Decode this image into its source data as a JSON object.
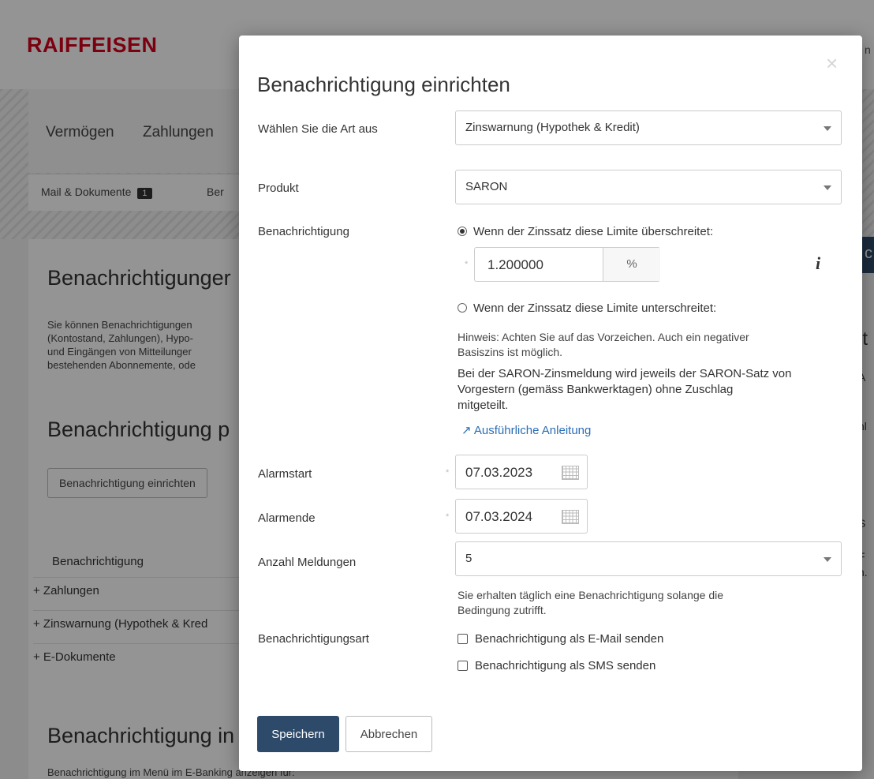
{
  "background": {
    "logo": "RAIFFEISEN",
    "top_right_fragment": "n",
    "nav": [
      "Vermögen",
      "Zahlungen"
    ],
    "subnav": {
      "mail_label": "Mail & Dokumente",
      "mail_count": "1",
      "second_fragment": "Ber"
    },
    "heading_1": "Benachrichtigunger",
    "intro_lines": [
      "Sie können Benachrichtigungen",
      "(Kontostand, Zahlungen), Hypo-",
      "und Eingängen von Mitteilunger",
      "bestehenden Abonnemente, ode"
    ],
    "heading_2": "Benachrichtigung p",
    "create_button": "Benachrichtigung einrichten",
    "table_header": "Benachrichtigung",
    "rows": [
      "+ Zahlungen",
      "+ Zinswarnung (Hypothek & Kred",
      "+ E-Dokumente"
    ],
    "heading_3": "Benachrichtigung in",
    "footer_text": "Benachrichtigung im Menü im E-Banking anzeigen für:",
    "right_fragments": [
      "it",
      "A",
      "hl",
      "S",
      "F",
      "n."
    ],
    "right_button": "c"
  },
  "modal": {
    "title": "Benachrichtigung einrichten",
    "close_icon": "×",
    "type_label": "Wählen Sie die Art aus",
    "type_value": "Zinswarnung (Hypothek & Kredit)",
    "product_label": "Produkt",
    "product_value": "SARON",
    "notification_label": "Benachrichtigung",
    "radio_exceed": "Wenn der Zinssatz diese Limite überschreitet:",
    "rate_value": "1.200000",
    "rate_unit": "%",
    "info_icon": "i",
    "radio_below": "Wenn der Zinssatz diese Limite unterschreitet:",
    "hint_lines": [
      "Hinweis: Achten Sie auf das Vorzeichen. Auch ein negativer",
      "Basiszins ist möglich."
    ],
    "saron_note_lines": [
      "Bei der SARON-Zinsmeldung wird jeweils der SARON-Satz von",
      "Vorgestern (gemäss Bankwerktagen) ohne Zuschlag",
      "mitgeteilt."
    ],
    "guide_link": "↗ Ausführliche Anleitung",
    "start_label": "Alarmstart",
    "start_value": "07.03.2023",
    "end_label": "Alarmende",
    "end_value": "07.03.2024",
    "count_label": "Anzahl Meldungen",
    "count_value": "5",
    "count_hint_lines": [
      "Sie erhalten täglich eine Benachrichtigung solange die",
      "Bedingung zutrifft."
    ],
    "delivery_label": "Benachrichtigungsart",
    "email_option": "Benachrichtigung als E-Mail senden",
    "sms_option": "Benachrichtigung als SMS senden",
    "save_button": "Speichern",
    "cancel_button": "Abbrechen",
    "required_marker": "*"
  },
  "colors": {
    "brand_red": "#d5001c",
    "primary_button": "#2d4a6a",
    "link": "#2a6db5"
  }
}
